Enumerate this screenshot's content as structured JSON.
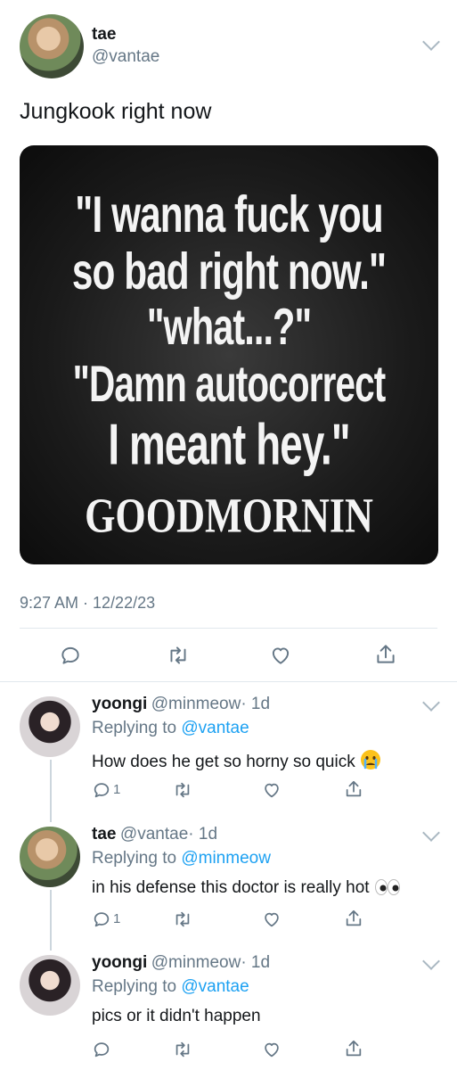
{
  "main_tweet": {
    "name": "tae",
    "handle": "@vantae",
    "text": "Jungkook right now",
    "timestamp": "9:27 AM · 12/22/23",
    "image_text": {
      "line1": "\"I wanna fuck you",
      "line2": "so bad right now.\"",
      "line3": "\"what...?\"",
      "line4": "\"Damn autocorrect",
      "line5": "I meant hey.\"",
      "line6": "GOODMORNIN"
    }
  },
  "replies": [
    {
      "name": "yoongi",
      "handle": "@minmeow",
      "time": "· 1d",
      "replying_label": "Replying to",
      "replying_to": "@vantae",
      "text": "How does he get so horny so quick",
      "emoji": "crying-face",
      "reply_count": "1"
    },
    {
      "name": "tae",
      "handle": "@vantae",
      "time": "· 1d",
      "replying_label": "Replying to",
      "replying_to": "@minmeow",
      "text": "in his defense this doctor is really hot",
      "emoji": "eyes",
      "reply_count": "1"
    },
    {
      "name": "yoongi",
      "handle": "@minmeow",
      "time": "· 1d",
      "replying_label": "Replying to",
      "replying_to": "@vantae",
      "text": "pics or it didn't happen",
      "emoji": "",
      "reply_count": ""
    }
  ],
  "colors": {
    "link": "#1da1f2",
    "secondary_text": "#657786",
    "divider": "#e1e8ed"
  },
  "icons": [
    "reply-icon",
    "retweet-icon",
    "like-icon",
    "share-icon",
    "chevron-down-icon"
  ]
}
